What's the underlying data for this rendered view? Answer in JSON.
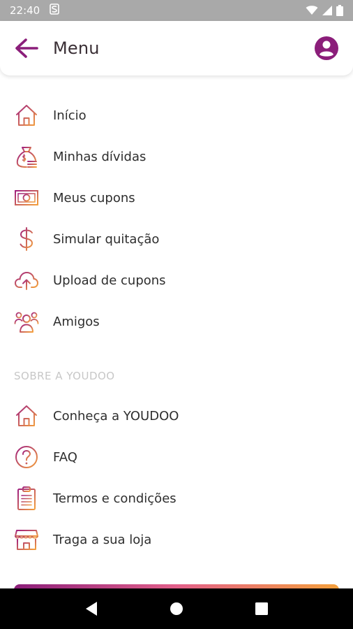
{
  "status_bar": {
    "time": "22:40",
    "notification_icon": "s-icon"
  },
  "app_bar": {
    "title": "Menu"
  },
  "menu": {
    "items": [
      {
        "label": "Início",
        "icon": "home-icon"
      },
      {
        "label": "Minhas dívidas",
        "icon": "money-bag-icon"
      },
      {
        "label": "Meus cupons",
        "icon": "banknote-icon"
      },
      {
        "label": "Simular quitação",
        "icon": "dollar-icon"
      },
      {
        "label": "Upload de cupons",
        "icon": "cloud-upload-icon"
      },
      {
        "label": "Amigos",
        "icon": "friends-icon"
      }
    ]
  },
  "about": {
    "title": "SOBRE A YOUDOO",
    "items": [
      {
        "label": "Conheça a YOUDOO",
        "icon": "home-icon"
      },
      {
        "label": "FAQ",
        "icon": "question-icon"
      },
      {
        "label": "Termos e condições",
        "icon": "clipboard-icon"
      },
      {
        "label": "Traga a sua loja",
        "icon": "store-icon"
      }
    ]
  },
  "colors": {
    "accent": "#8b1e7a",
    "icon_gradient_start": "#a0207f",
    "icon_gradient_end": "#f4a03c",
    "section_title": "#c7c7c7",
    "status_bar": "#a9a9a9"
  }
}
